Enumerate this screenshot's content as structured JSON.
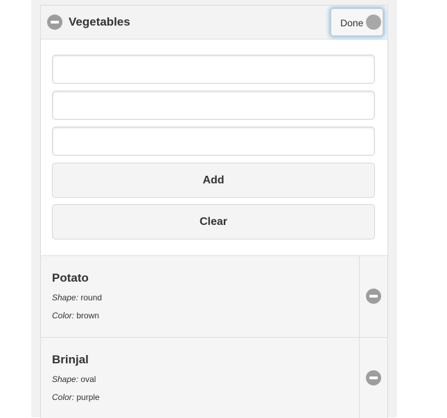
{
  "header": {
    "title": "Vegetables",
    "done_label": "Done"
  },
  "form": {
    "fields": [
      {
        "value": "",
        "placeholder": ""
      },
      {
        "value": "",
        "placeholder": ""
      },
      {
        "value": "",
        "placeholder": ""
      }
    ],
    "add_label": "Add",
    "clear_label": "Clear"
  },
  "items": [
    {
      "name": "Potato",
      "shape_label": "Shape:",
      "shape": "round",
      "color_label": "Color:",
      "color": "brown"
    },
    {
      "name": "Brinjal",
      "shape_label": "Shape:",
      "shape": "oval",
      "color_label": "Color:",
      "color": "purple"
    }
  ],
  "icons": {
    "collapse": "minus-circle-icon",
    "delete": "minus-circle-icon",
    "toggle": "toggle-knob-icon"
  },
  "colors": {
    "icon_gray": "#9d9d9d",
    "focus_glow": "#8fbfe8"
  }
}
